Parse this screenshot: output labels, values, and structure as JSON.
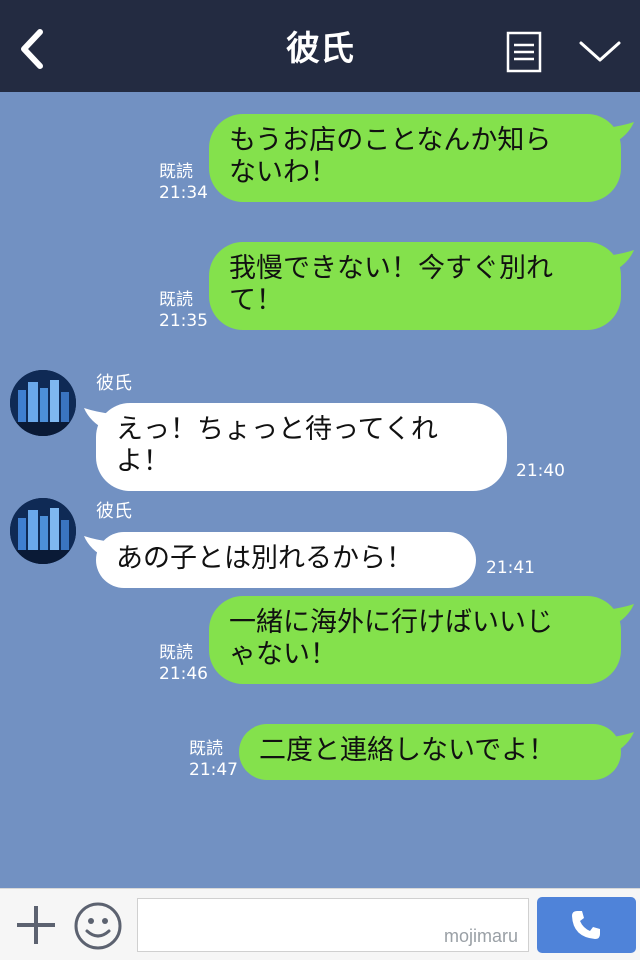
{
  "header": {
    "title": "彼氏",
    "back_icon": "chevron-left-icon",
    "menu_icon": "menu-lines-icon",
    "dropdown_icon": "chevron-down-icon"
  },
  "messages": [
    {
      "side": "out",
      "line1": "もうお店のことなんか知ら",
      "line2": "ないわ！",
      "read": "既読",
      "time": "21:34"
    },
    {
      "side": "out",
      "line1": "我慢できない！今すぐ別れ",
      "line2": "て！",
      "read": "既読",
      "time": "21:35"
    },
    {
      "side": "in",
      "sender": "彼氏",
      "line1": "えっ！ちょっと待ってくれ",
      "line2": "よ！",
      "time": "21:40"
    },
    {
      "side": "in",
      "sender": "彼氏",
      "line1": "あの子とは別れるから！",
      "time": "21:41"
    },
    {
      "side": "out",
      "line1": "一緒に海外に行けばいいじ",
      "line2": "ゃない！",
      "read": "既読",
      "time": "21:46"
    },
    {
      "side": "out",
      "line1": "二度と連絡しないでよ！",
      "read": "既読",
      "time": "21:47"
    }
  ],
  "input_bar": {
    "plus_icon": "plus-icon",
    "emoji_icon": "smiley-icon",
    "watermark": "mojimaru",
    "call_icon": "phone-icon"
  },
  "colors": {
    "header_bg": "#232b41",
    "chat_bg": "#7291c2",
    "outgoing_bubble": "#84e14c",
    "incoming_bubble": "#ffffff",
    "call_button": "#4f83d9"
  }
}
